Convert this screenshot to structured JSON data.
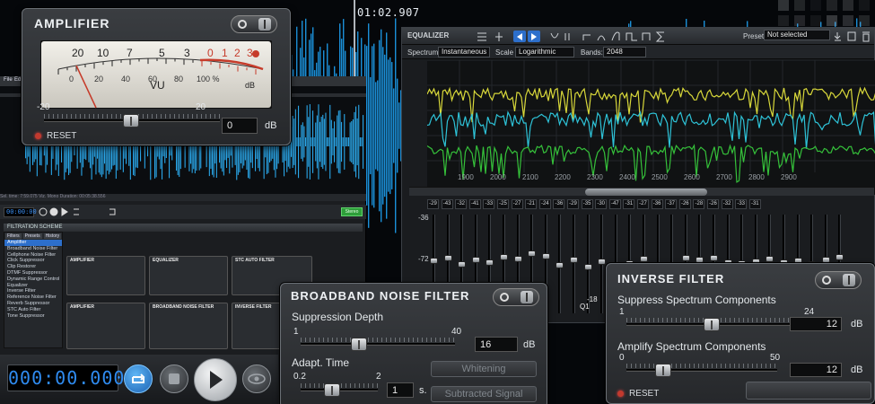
{
  "background": {
    "time_readout": "01:02.907"
  },
  "amplifier": {
    "title": "AMPLIFIER",
    "vu_top_scale": [
      "20",
      "10",
      "7",
      "5",
      "3",
      "0",
      "1",
      "2",
      "3"
    ],
    "vu_bottom_scale": [
      "0",
      "20",
      "40",
      "60",
      "80",
      "100 %"
    ],
    "vu_label": "VU",
    "vu_unit": "dB",
    "slider_min": "-20",
    "slider_max": "20",
    "value": "0",
    "unit": "dB",
    "reset_label": "RESET"
  },
  "equalizer": {
    "title": "EQUALIZER",
    "preset_label": "Preset",
    "preset_value": "Not selected",
    "spectrum_label": "Spectrum",
    "spectrum_value": "Instantaneous",
    "scale_label": "Scale",
    "scale_value": "Logarithmic",
    "bands_label": "Bands:",
    "bands_value": "2048",
    "freq_ticks": [
      "1900",
      "2000",
      "2100",
      "2200",
      "2300",
      "2400",
      "2500",
      "2600",
      "2700",
      "2800",
      "2900"
    ],
    "band_values": [
      "-29",
      "-43",
      "-32",
      "-41",
      "-33",
      "-25",
      "-27",
      "-21",
      "-24",
      "-36",
      "-29",
      "-35",
      "-30",
      "-47",
      "-31",
      "-27",
      "-36",
      "-37",
      "-26",
      "-28",
      "-26",
      "-32",
      "-33",
      "-31"
    ],
    "left_scale": [
      "-36",
      "-72"
    ],
    "marker_labels": [
      "Q1",
      "-18"
    ],
    "band_levels": [
      0.48,
      0.45,
      0.52,
      0.47,
      0.5,
      0.44,
      0.46,
      0.4,
      0.43,
      0.53,
      0.47,
      0.55,
      0.49,
      0.6,
      0.51,
      0.46,
      0.54,
      0.55,
      0.45,
      0.47,
      0.45,
      0.5,
      0.51,
      0.49,
      0.46,
      0.5,
      0.48,
      0.52,
      0.47,
      0.44
    ]
  },
  "app": {
    "menu": [
      "File",
      "Edit"
    ],
    "strip_text": "Sel. time: 7:59.075  Viz. Mono  Duration: 00:05:38.556",
    "small_time": "00:00:00",
    "green_button": "Stereo",
    "filtration_scheme": "FILTRATION SCHEME",
    "tabs": [
      "Filters",
      "Presets",
      "History"
    ],
    "filters": [
      "Amplifier",
      "Broadband Noise Filter",
      "Cellphone Noise Filter",
      "Click Suppressor",
      "Clip Restorer",
      "DTMF Suppressor",
      "Dynamic Range Control",
      "Equalizer",
      "Inverse Filter",
      "Reference Noise Filter",
      "Reverb Suppressor",
      "STC Auto Filter",
      "Tone Suppressor"
    ],
    "mini_panels": [
      "AMPLIFIER",
      "EQUALIZER",
      "STC AUTO FILTER",
      "AMPLIFIER",
      "BROADBAND NOISE FILTER",
      "INVERSE FILTER"
    ]
  },
  "transport": {
    "time": "000:00.000"
  },
  "broadband": {
    "title": "BROADBAND NOISE FILTER",
    "suppression_label": "Suppression Depth",
    "suppression_min": "1",
    "suppression_max": "40",
    "suppression_value": "16",
    "suppression_unit": "dB",
    "whitening_label": "Whitening",
    "adapt_label": "Adapt. Time",
    "adapt_min": "0.2",
    "adapt_max": "2",
    "adapt_value": "1",
    "adapt_unit": "s.",
    "subtracted_label": "Subtracted Signal"
  },
  "inverse": {
    "title": "INVERSE FILTER",
    "suppress_label": "Suppress Spectrum Components",
    "suppress_min": "1",
    "suppress_max": "24",
    "suppress_value": "12",
    "suppress_unit": "dB",
    "amplify_label": "Amplify Spectrum Components",
    "amplify_min": "0",
    "amplify_max": "50",
    "amplify_value": "12",
    "amplify_unit": "dB",
    "reset_label": "RESET"
  }
}
